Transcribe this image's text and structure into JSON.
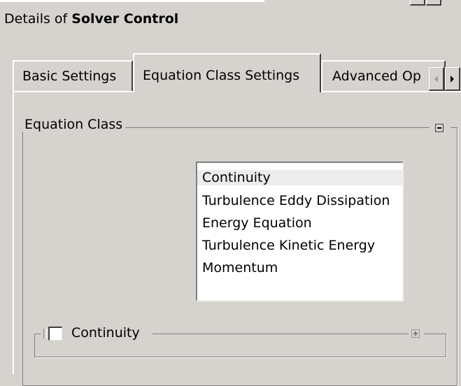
{
  "header": {
    "title_prefix": "Details of ",
    "title_bold": "Solver Control"
  },
  "tabs": [
    {
      "label": "Basic Settings",
      "active": false
    },
    {
      "label": "Equation Class Settings",
      "active": true
    },
    {
      "label": "Advanced Op",
      "active": false
    }
  ],
  "tab_scroll": {
    "left_icon": "arrow-left-icon",
    "right_icon": "arrow-right-icon"
  },
  "equation_class_group": {
    "legend": "Equation Class",
    "collapse_icon": "minus-box-icon",
    "list_items": [
      "Continuity",
      "Turbulence Eddy Dissipation",
      "Energy Equation",
      "Turbulence Kinetic Energy",
      "Momentum"
    ],
    "selected_item": "Continuity"
  },
  "continuity_group": {
    "label": "Continuity",
    "checked": false,
    "expand_icon": "plus-box-icon"
  }
}
